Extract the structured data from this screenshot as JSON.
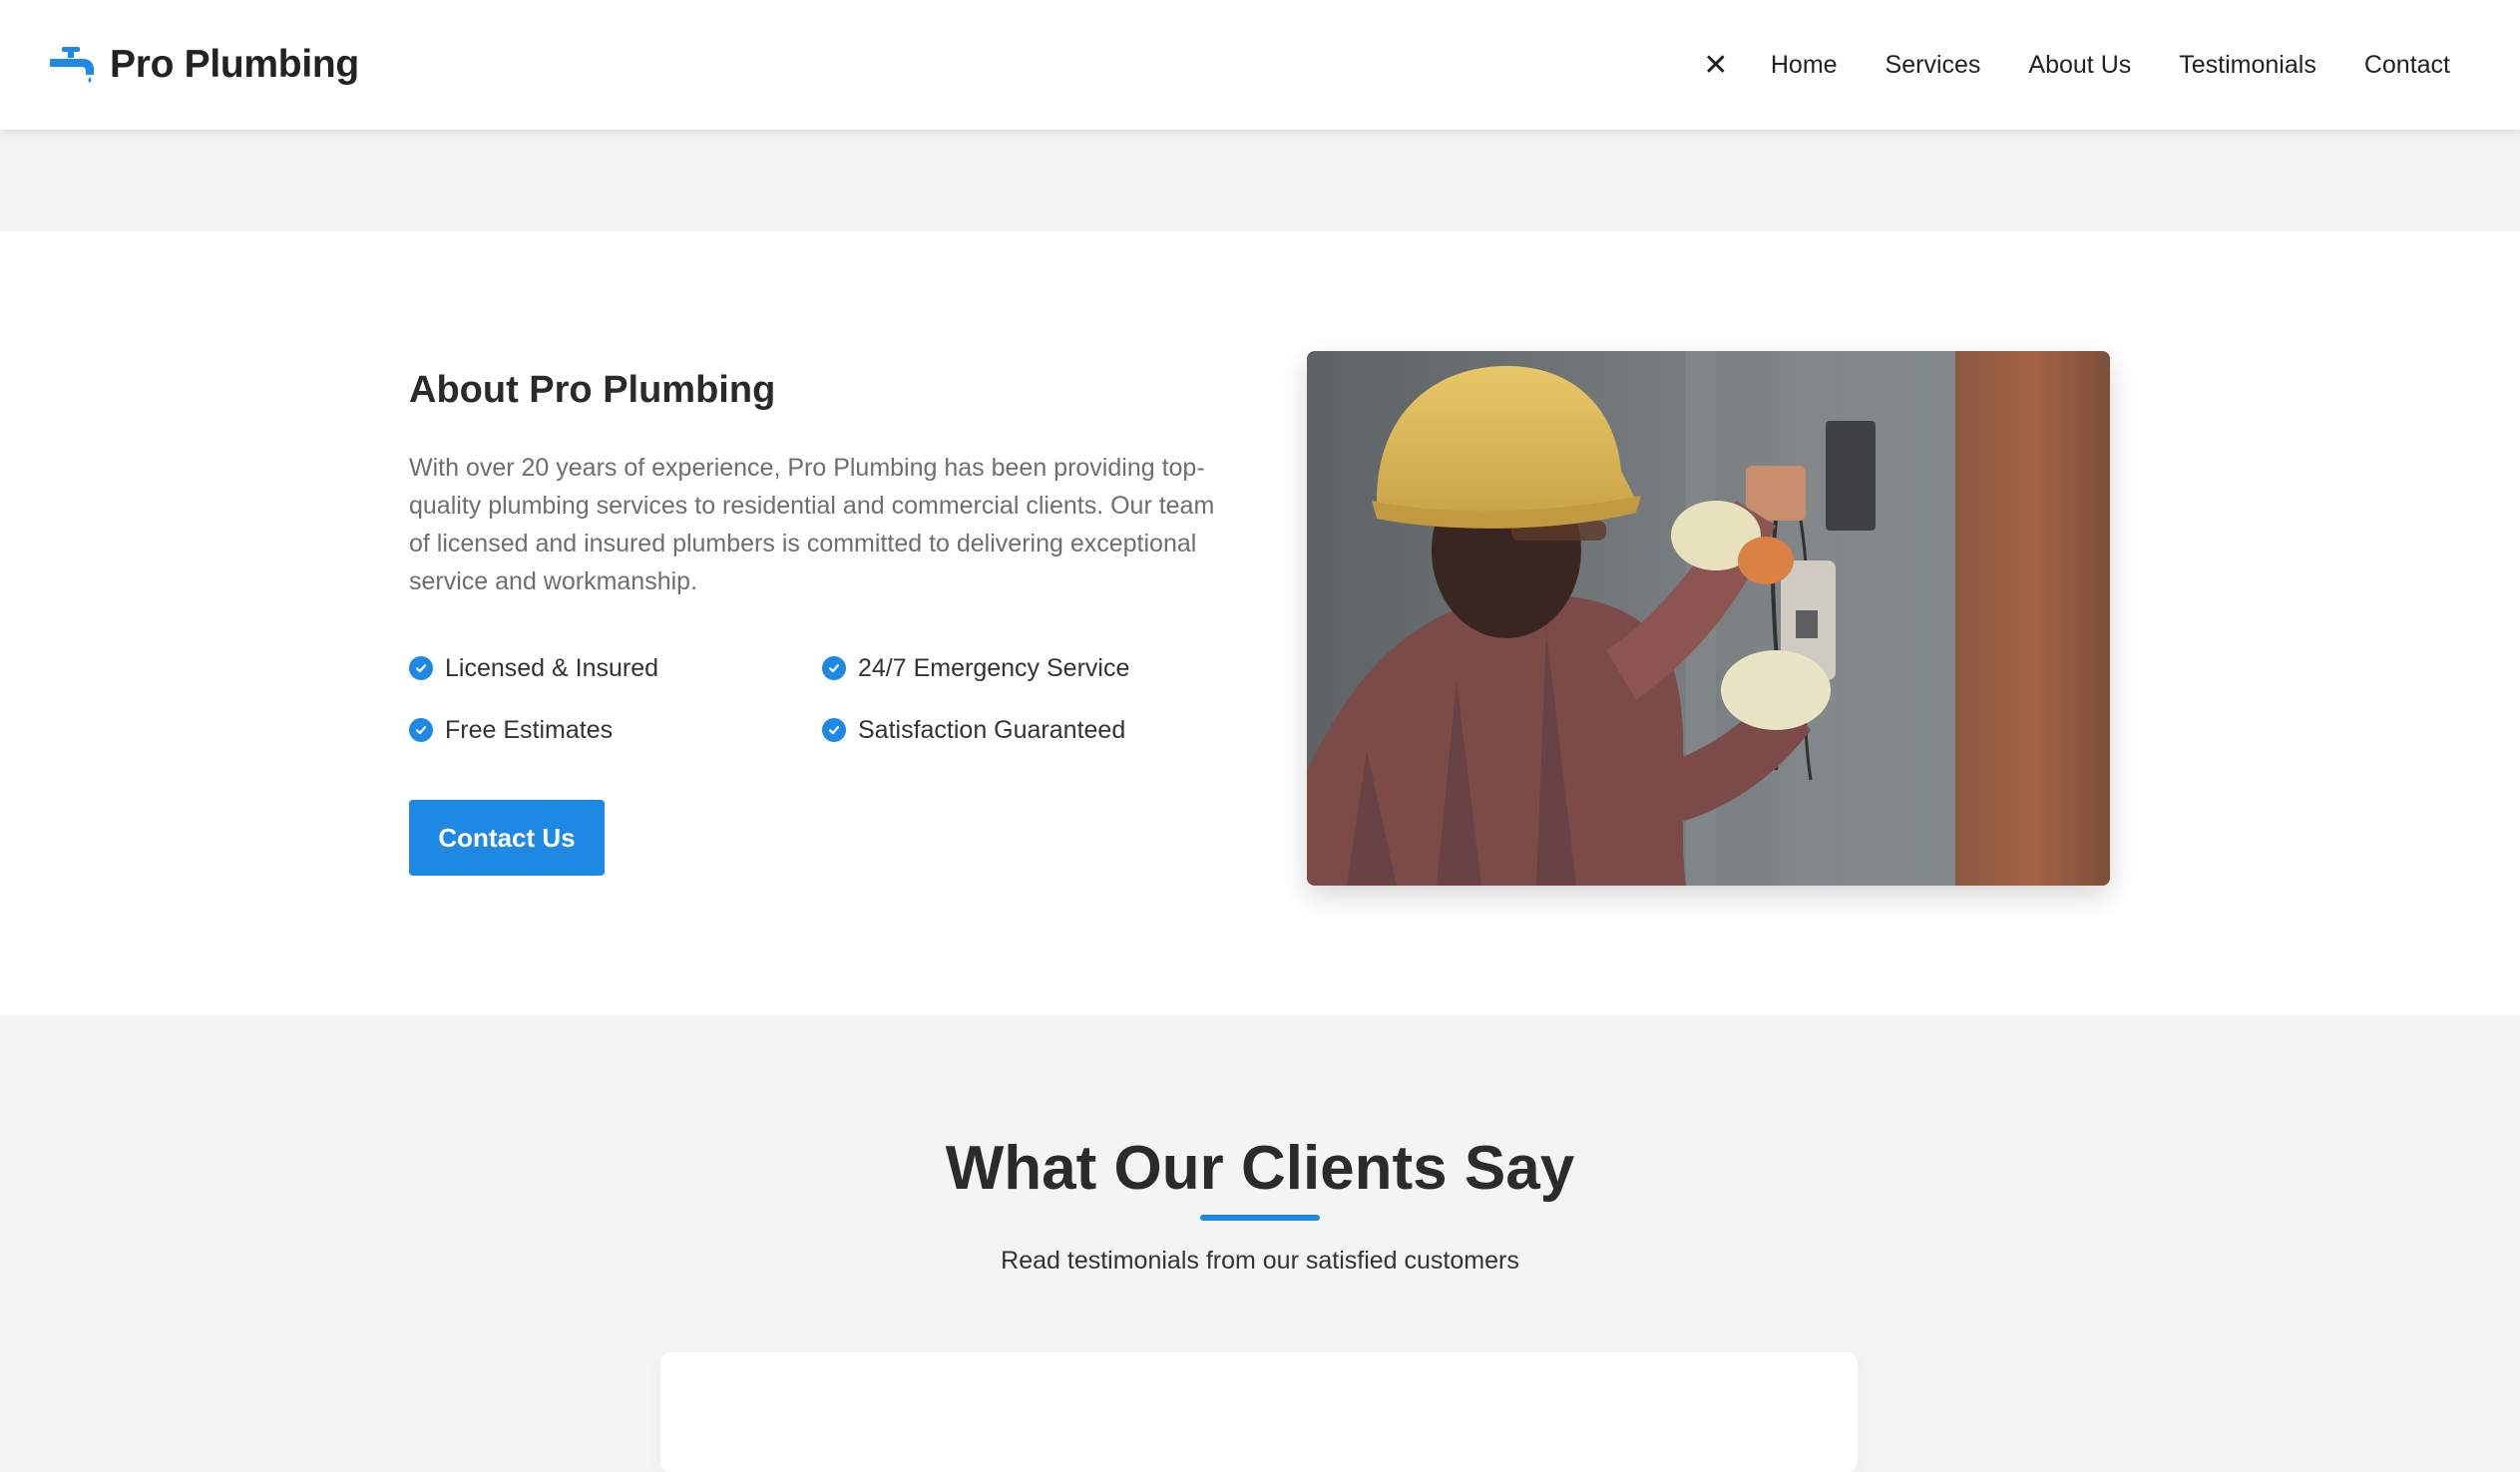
{
  "brand": {
    "name": "Pro Plumbing",
    "icon": "faucet-icon",
    "accent": "#1e88e5"
  },
  "nav": {
    "close_icon": "✕",
    "items": [
      "Home",
      "Services",
      "About Us",
      "Testimonials",
      "Contact"
    ]
  },
  "about": {
    "title": "About Pro Plumbing",
    "description": "With over 20 years of experience, Pro Plumbing has been providing top-quality plumbing services to residential and commercial clients. Our team of licensed and insured plumbers is committed to delivering exceptional service and workmanship.",
    "features": [
      "Licensed & Insured",
      "24/7 Emergency Service",
      "Free Estimates",
      "Satisfaction Guaranteed"
    ],
    "cta_label": "Contact Us"
  },
  "testimonials": {
    "title": "What Our Clients Say",
    "subtitle": "Read testimonials from our satisfied customers"
  }
}
